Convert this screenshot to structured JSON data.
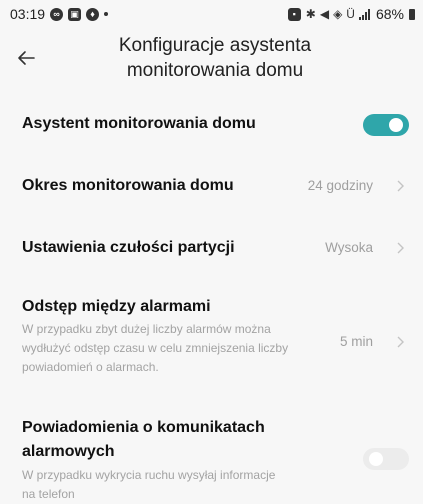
{
  "status_bar": {
    "time": "03:19",
    "icons_left": [
      "data-saver-icon",
      "gallery-icon",
      "app-notification-icon"
    ],
    "icons_right": [
      "silent-mode-icon",
      "bluetooth-icon",
      "volte-icon",
      "wifi-icon",
      "signal-icon"
    ],
    "network_label": "Ü",
    "battery": "68%"
  },
  "header": {
    "title": "Konfiguracje asystenta monitorowania domu"
  },
  "settings": {
    "assistant": {
      "title": "Asystent monitorowania domu",
      "enabled": true
    },
    "period": {
      "title": "Okres monitorowania domu",
      "value": "24 godziny"
    },
    "sensitivity": {
      "title": "Ustawienia czułości partycji",
      "value": "Wysoka"
    },
    "alarm_interval": {
      "title": "Odstęp między alarmami",
      "description": "W przypadku zbyt dużej liczby alarmów można wydłużyć odstęp czasu w celu zmniejszenia liczby powiadomień o alarmach.",
      "value": "5 min"
    },
    "notifications": {
      "title": "Powiadomienia o komunikatach alarmowych",
      "description": "W przypadku wykrycia ruchu wysyłaj informacje na telefon",
      "enabled": false
    }
  },
  "colors": {
    "accent": "#2fa6aa",
    "toggle_off": "#ececec",
    "secondary_text": "#a3a3a3"
  }
}
